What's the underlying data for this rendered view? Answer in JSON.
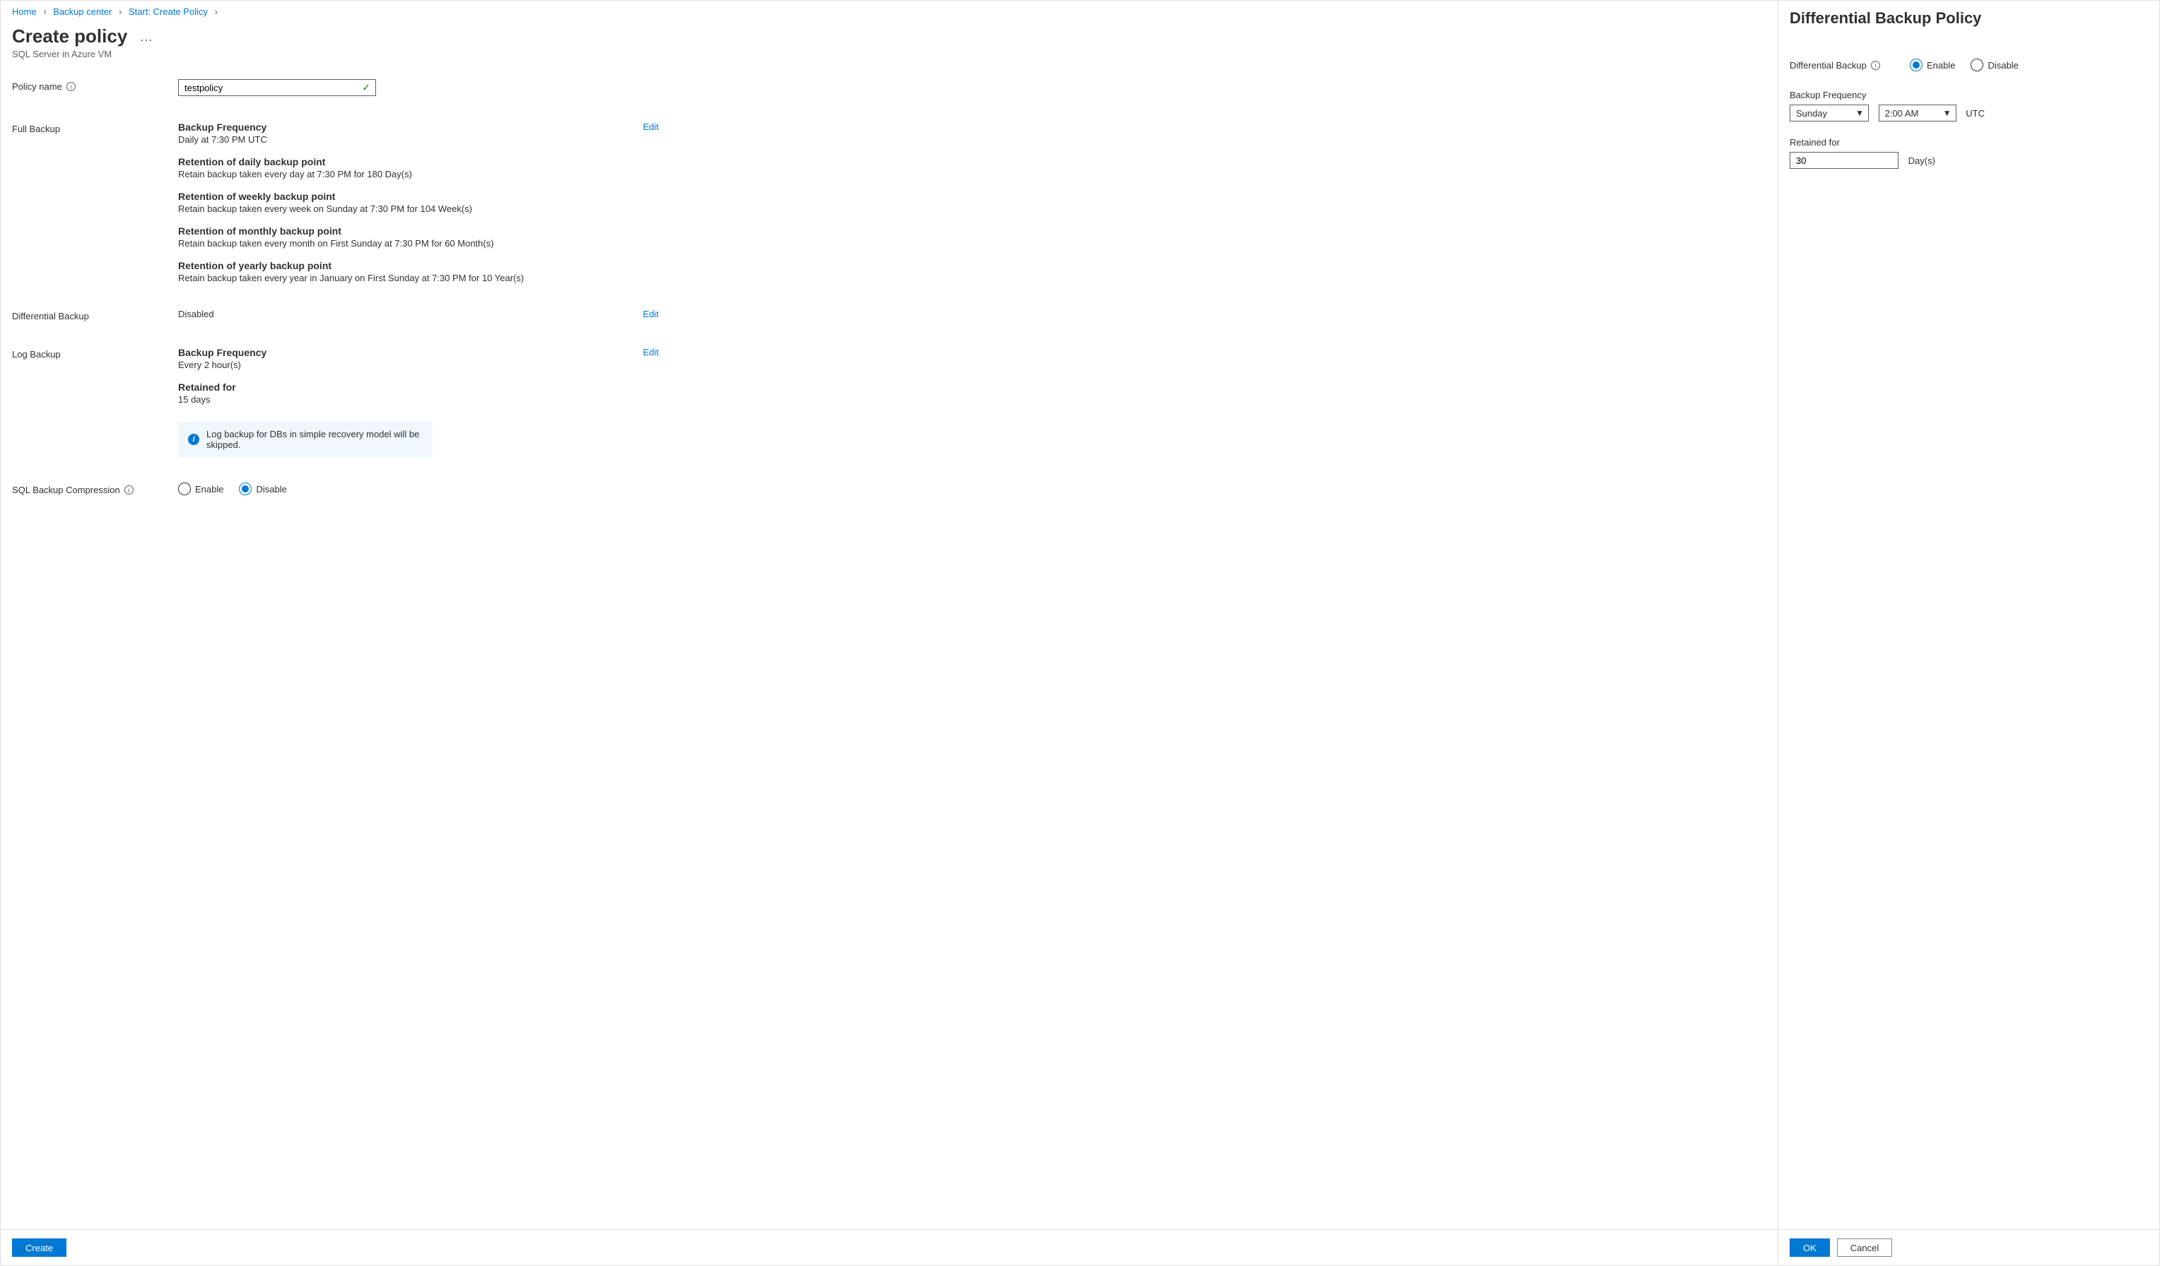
{
  "breadcrumb": {
    "items": [
      "Home",
      "Backup center",
      "Start: Create Policy"
    ]
  },
  "page": {
    "title": "Create policy",
    "subtitle": "SQL Server in Azure VM"
  },
  "labels": {
    "policy_name": "Policy name",
    "full_backup": "Full Backup",
    "diff_backup": "Differential Backup",
    "log_backup": "Log Backup",
    "sql_compression": "SQL Backup Compression",
    "edit": "Edit",
    "enable": "Enable",
    "disable": "Disable"
  },
  "policy_name_value": "testpolicy",
  "full_backup": {
    "h1": "Backup Frequency",
    "t1": "Daily at 7:30 PM UTC",
    "h2": "Retention of daily backup point",
    "t2": "Retain backup taken every day at 7:30 PM for 180 Day(s)",
    "h3": "Retention of weekly backup point",
    "t3": "Retain backup taken every week on Sunday at 7:30 PM for 104 Week(s)",
    "h4": "Retention of monthly backup point",
    "t4": "Retain backup taken every month on First Sunday at 7:30 PM for 60 Month(s)",
    "h5": "Retention of yearly backup point",
    "t5": "Retain backup taken every year in January on First Sunday at 7:30 PM for 10 Year(s)"
  },
  "diff_backup_status": "Disabled",
  "log_backup": {
    "h1": "Backup Frequency",
    "t1": "Every 2 hour(s)",
    "h2": "Retained for",
    "t2": "15 days",
    "info": "Log backup for DBs in simple recovery model will be skipped."
  },
  "buttons": {
    "create": "Create",
    "ok": "OK",
    "cancel": "Cancel"
  },
  "panel": {
    "title": "Differential Backup Policy",
    "diff_label": "Differential Backup",
    "freq_label": "Backup Frequency",
    "day_value": "Sunday",
    "time_value": "2:00 AM",
    "utc": "UTC",
    "retained_label": "Retained for",
    "retained_value": "30",
    "retained_unit": "Day(s)"
  }
}
